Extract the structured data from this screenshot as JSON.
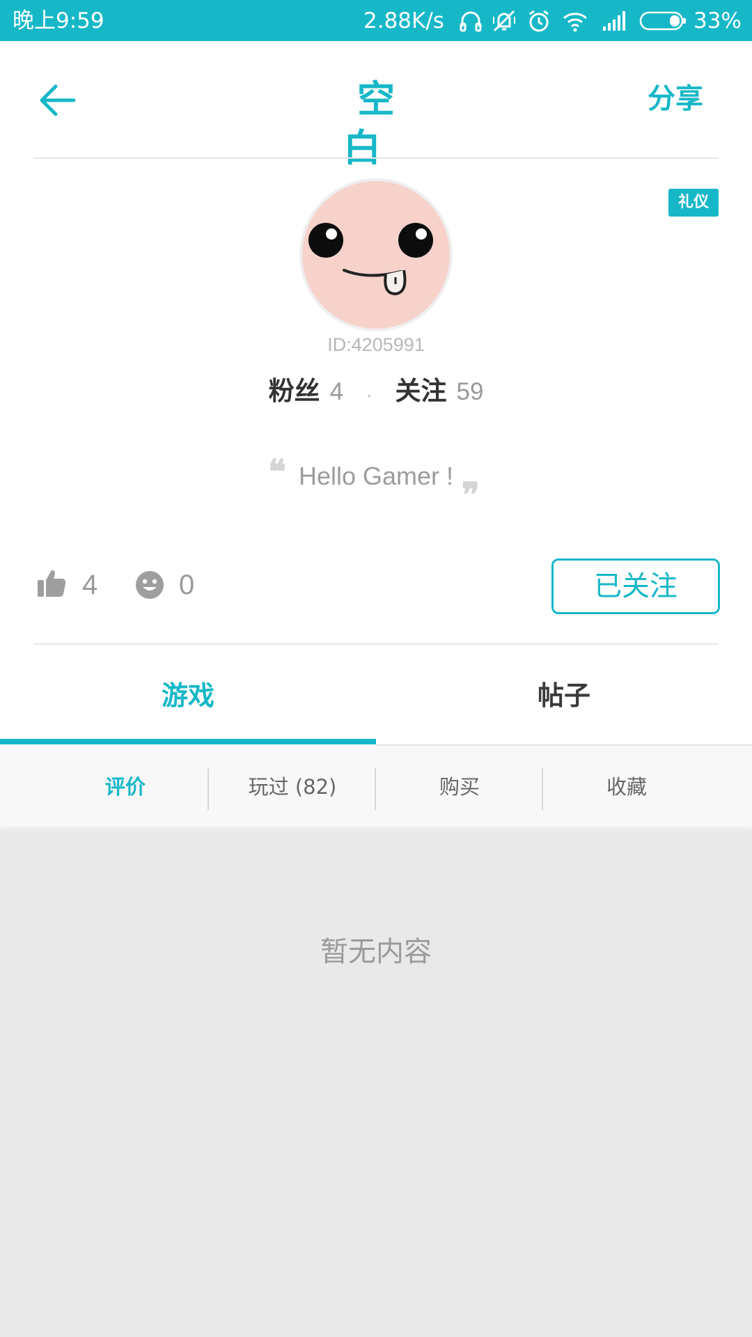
{
  "status_bar": {
    "time": "晚上9:59",
    "net_speed": "2.88K/s",
    "battery_percent": "33%",
    "battery_level": 0.33,
    "icons": [
      "headphones-icon",
      "vibrate-mute-icon",
      "alarm-icon",
      "wifi-icon",
      "signal-icon",
      "battery-icon"
    ]
  },
  "header": {
    "title": "空白",
    "share_label": "分享"
  },
  "profile": {
    "badge": "礼仪",
    "user_id": "ID:4205991",
    "fans_label": "粉丝",
    "fans_count": "4",
    "separator": "·",
    "following_label": "关注",
    "following_count": "59",
    "signature": "Hello Gamer !",
    "quote_open": "❝",
    "quote_close": "❞"
  },
  "actions": {
    "like_count": "4",
    "smile_count": "0",
    "follow_status": "已关注"
  },
  "tabs": [
    {
      "label": "游戏",
      "active": true
    },
    {
      "label": "帖子",
      "active": false
    }
  ],
  "sub_tabs": [
    {
      "label": "评价",
      "active": true
    },
    {
      "label": "玩过 (82)",
      "active": false
    },
    {
      "label": "购买",
      "active": false
    },
    {
      "label": "收藏",
      "active": false
    }
  ],
  "content": {
    "empty_message": "暂无内容"
  },
  "colors": {
    "accent": "#16b8c8",
    "avatar_bg": "#f6d2cb",
    "content_bg": "#e9e9e9"
  }
}
